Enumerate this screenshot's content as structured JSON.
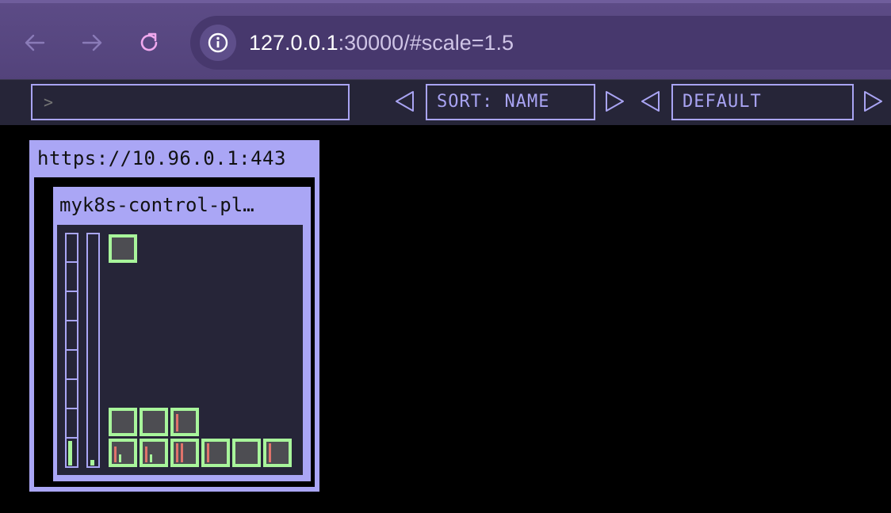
{
  "browser": {
    "url_host": "127.0.0.1",
    "url_rest": ":30000/#scale=1.5"
  },
  "toolbar": {
    "query_placeholder": ">",
    "sort_label": "SORT: NAME",
    "theme_label": "DEFAULT"
  },
  "cluster": {
    "title": "https://10.96.0.1:443",
    "node": {
      "title": "myk8s-control-pl…",
      "pod_rows": [
        {
          "count": 1
        },
        {
          "count": 3
        },
        {
          "count": 6
        }
      ]
    }
  },
  "colors": {
    "accent": "#aaa6f5",
    "pod_ok": "#a8f59b",
    "cpu_bar": "#e0736b",
    "panel_bg": "#262538"
  }
}
